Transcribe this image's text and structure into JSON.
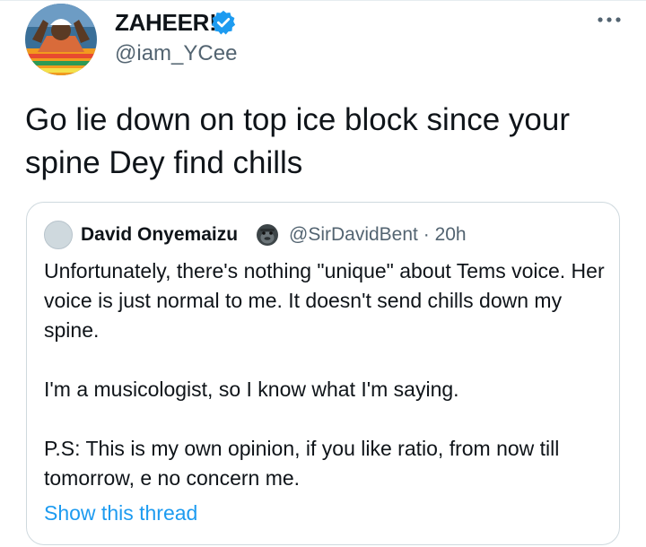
{
  "tweet": {
    "author_name": "ZAHEER!",
    "author_handle": "@iam_YCee",
    "verified_icon": "verified-badge-icon",
    "more_icon": "more-dots-icon",
    "text": "Go lie down on top ice block since your spine Dey find chills"
  },
  "quoted_tweet": {
    "author_name": "David Onyemaizu",
    "author_emoji_icon": "gorilla-emoji-icon",
    "author_handle": "@SirDavidBent",
    "separator": "·",
    "time": "20h",
    "paragraphs": [
      "Unfortunately, there's nothing \"unique\" about Tems voice. Her voice is just normal to me. It doesn't send chills down my spine.",
      "I'm a musicologist, so I know what I'm saying.",
      "P.S: This is my own opinion, if you like ratio, from now till tomorrow, e no concern me."
    ],
    "show_thread_label": "Show this thread"
  },
  "colors": {
    "accent": "#1d9bf0",
    "text": "#0f1419",
    "secondary": "#536471",
    "border": "#cfd9de"
  }
}
